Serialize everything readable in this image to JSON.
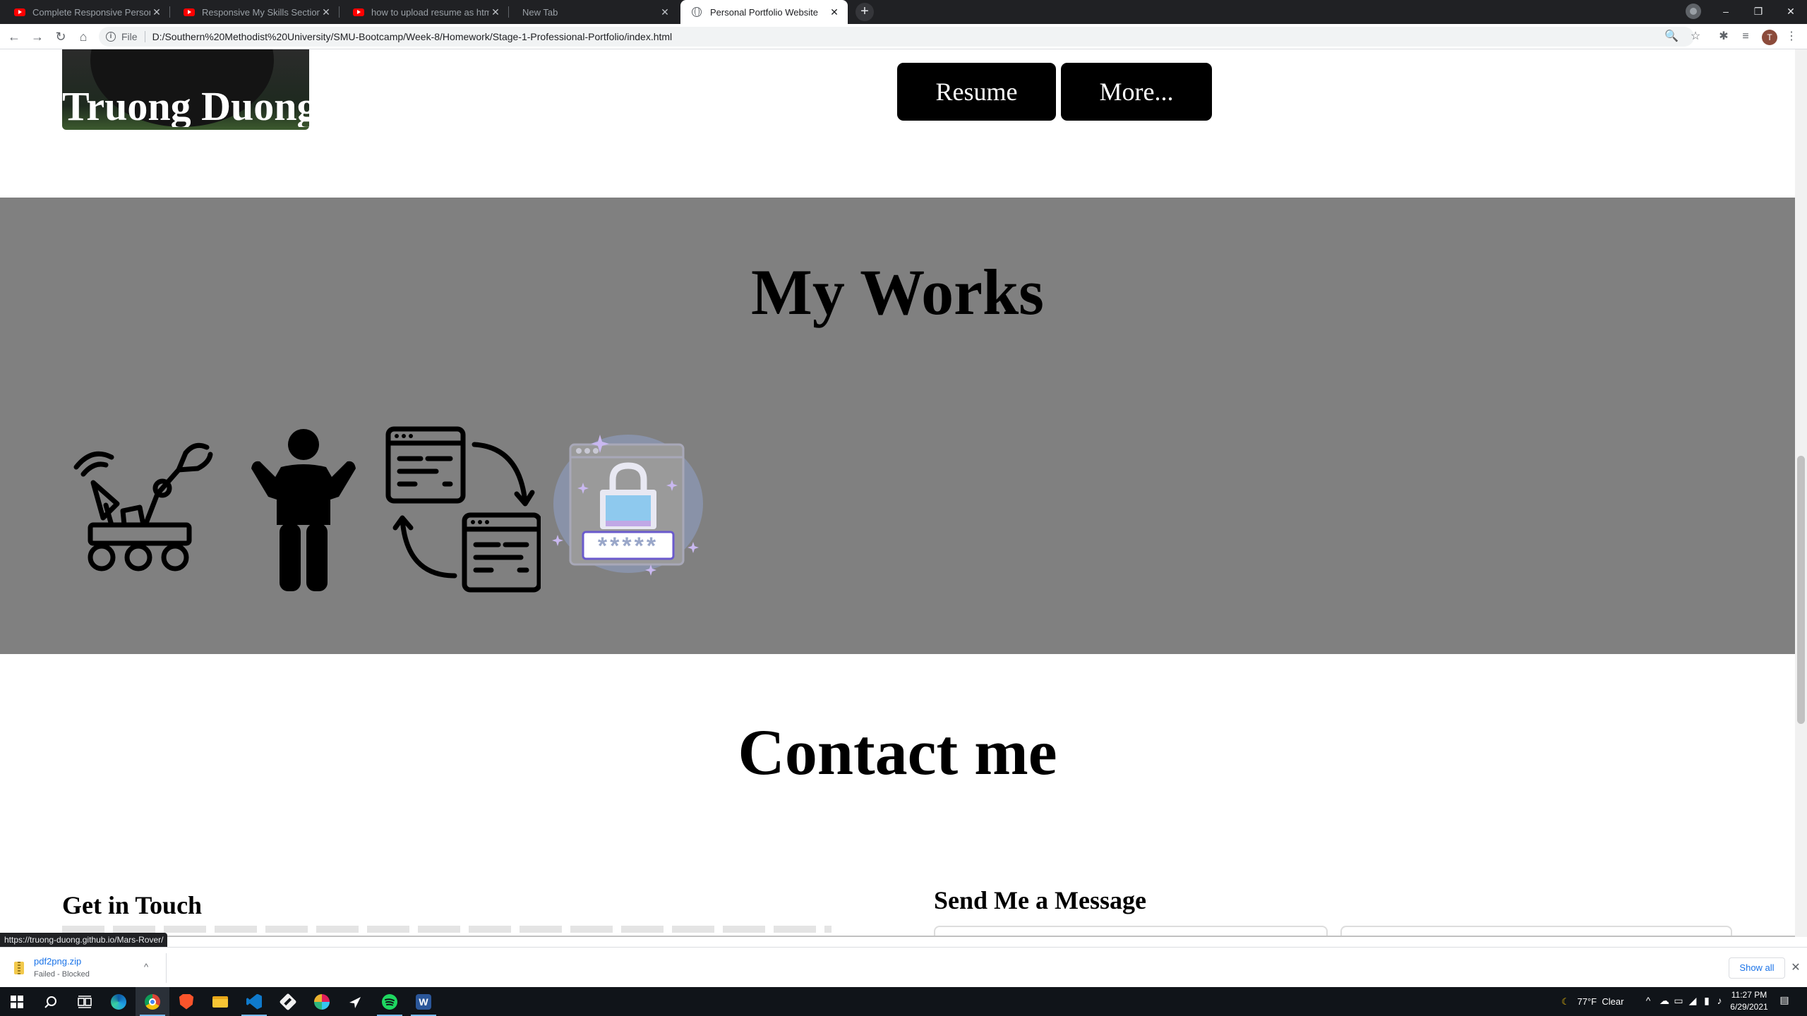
{
  "browser": {
    "tabs": [
      {
        "title": "Complete Responsive Personal P",
        "icon": "youtube-icon",
        "active": false
      },
      {
        "title": "Responsive My Skills Section Usin",
        "icon": "youtube-icon",
        "active": false
      },
      {
        "title": "how to upload resume as html - ",
        "icon": "youtube-icon",
        "active": false
      },
      {
        "title": "New Tab",
        "icon": "none",
        "active": false
      },
      {
        "title": "Personal Portfolio Website",
        "icon": "globe-icon",
        "active": true
      }
    ],
    "new_tab_symbol": "+",
    "window_controls": {
      "minimize": "–",
      "maximize": "❐",
      "close": "✕"
    },
    "nav": {
      "back": "←",
      "forward": "→",
      "reload": "↻",
      "home": "⌂"
    },
    "address": {
      "scheme_label": "File",
      "url": "D:/Southern%20Methodist%20University/SMU-Bootcamp/Week-8/Homework/Stage-1-Professional-Portfolio/index.html"
    },
    "toolbar_icons": {
      "zoom": "🔍",
      "bookmark": "☆",
      "extensions": "✱",
      "media": "≡",
      "menu": "⋮"
    },
    "profile_initial": "T",
    "status_url": "https://truong-duong.github.io/Mars-Rover/"
  },
  "page": {
    "hero": {
      "name": "Truong Duong"
    },
    "buttons": {
      "resume": "Resume",
      "more": "More..."
    },
    "works": {
      "title": "My Works",
      "items": [
        {
          "name": "Mars Rover",
          "icon": "rover-icon"
        },
        {
          "name": "Person",
          "icon": "person-icon"
        },
        {
          "name": "Converter",
          "icon": "convert-icon"
        },
        {
          "name": "Password",
          "icon": "password-icon"
        }
      ],
      "password_mask": "*****"
    },
    "contact": {
      "title": "Contact me",
      "get_in_touch": "Get in Touch",
      "send_message": "Send Me a Message"
    }
  },
  "downloads": {
    "file_name": "pdf2png.zip",
    "status": "Failed - Blocked",
    "show_all": "Show all",
    "close": "✕",
    "chevron": "^"
  },
  "taskbar": {
    "weather": {
      "temperature": "77°F",
      "condition": "Clear"
    },
    "time": "11:27 PM",
    "date": "6/29/2021",
    "apps": [
      "windows-start-icon",
      "search-icon",
      "task-view-icon",
      "edge-icon",
      "chrome-icon",
      "brave-icon",
      "file-explorer-icon",
      "vscode-icon",
      "git-icon",
      "slack-icon",
      "steam-icon",
      "spotify-icon",
      "word-icon"
    ]
  },
  "colors": {
    "works_bg": "#808080",
    "button_bg": "#000000",
    "tab_bar": "#202124",
    "taskbar": "#101419",
    "link_blue": "#1a73e8"
  }
}
